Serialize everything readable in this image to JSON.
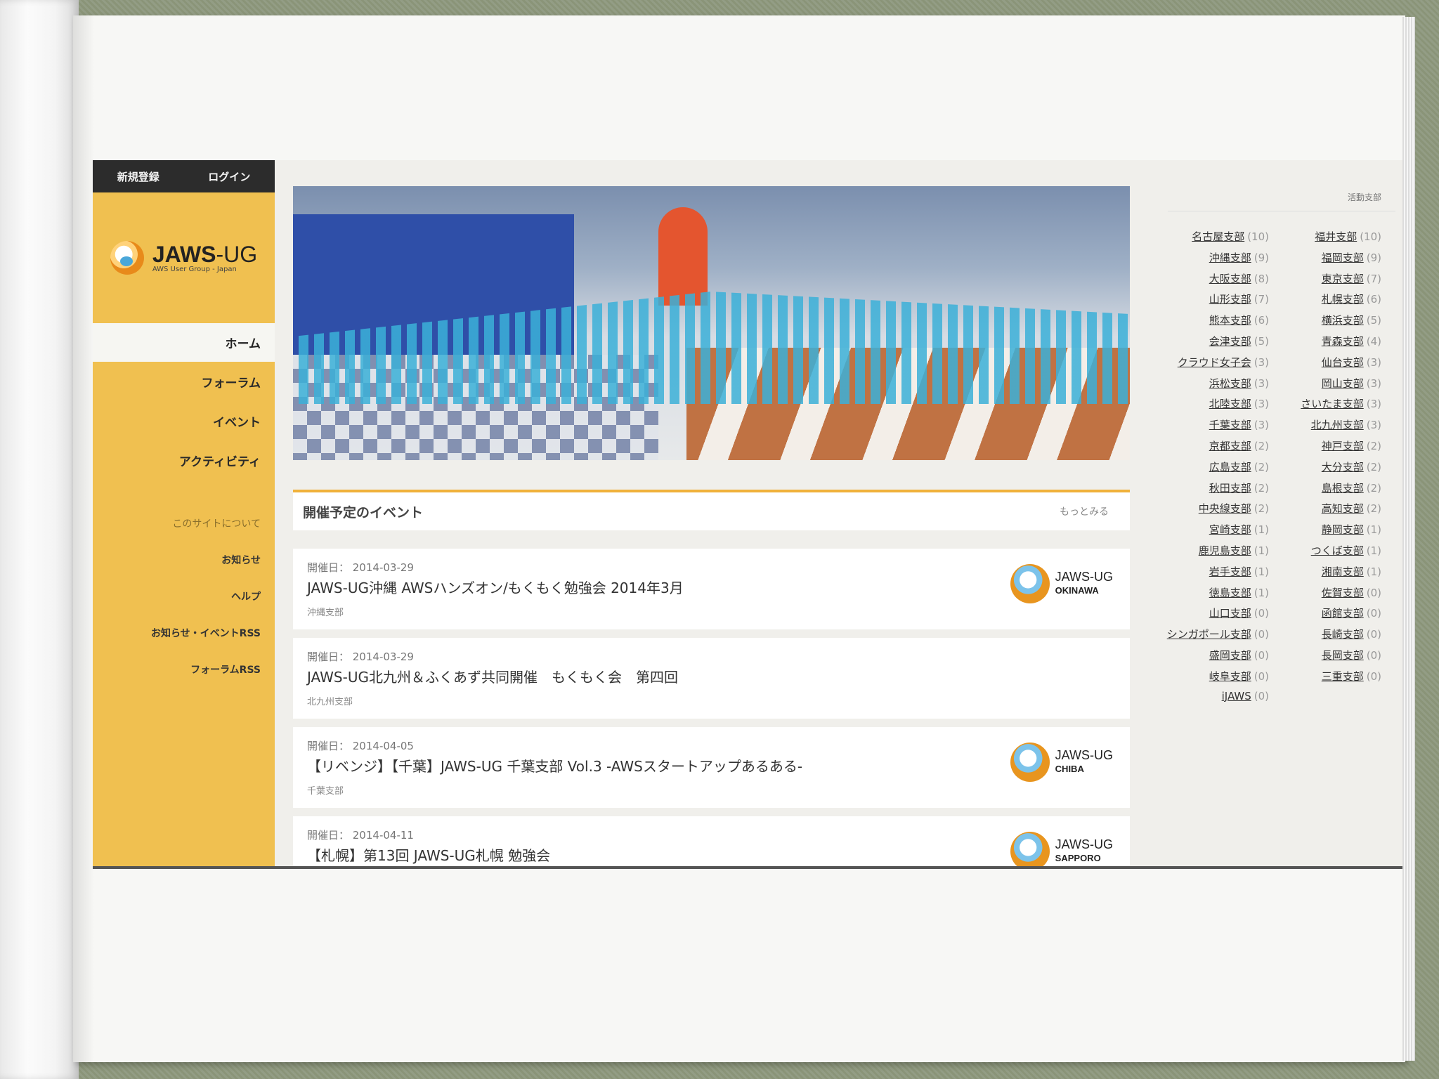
{
  "auth": {
    "register": "新規登録",
    "login": "ログイン"
  },
  "logo": {
    "title": "JAWS",
    "title_suffix": "-UG",
    "subtitle": "AWS User Group - Japan"
  },
  "nav": {
    "home": "ホーム",
    "forum": "フォーラム",
    "event": "イベント",
    "activity": "アクティビティ",
    "about": "このサイトについて",
    "news": "お知らせ",
    "help": "ヘルプ",
    "rss_news": "お知らせ・イベントRSS",
    "rss_forum": "フォーラムRSS"
  },
  "events": {
    "title": "開催予定のイベント",
    "more": "もっとみる",
    "items": [
      {
        "date": "開催日： 2014-03-29",
        "title": "JAWS-UG沖縄 AWSハンズオン/もくもく勉強会 2014年3月",
        "branch": "沖縄支部",
        "logo_text": "JAWS-UG",
        "logo_sub": "OKINAWA",
        "has_logo": true
      },
      {
        "date": "開催日： 2014-03-29",
        "title": "JAWS-UG北九州＆ふくあず共同開催　もくもく会　第四回",
        "branch": "北九州支部",
        "has_logo": false
      },
      {
        "date": "開催日： 2014-04-05",
        "title": "【リベンジ】【千葉】JAWS-UG 千葉支部 Vol.3 -AWSスタートアップあるある-",
        "branch": "千葉支部",
        "logo_text": "JAWS-UG",
        "logo_sub": "CHIBA",
        "has_logo": true
      },
      {
        "date": "開催日： 2014-04-11",
        "title": "【札幌】第13回 JAWS-UG札幌 勉強会",
        "branch": "",
        "logo_text": "JAWS-UG",
        "logo_sub": "SAPPORO",
        "has_logo": true
      }
    ]
  },
  "branches": {
    "title": "活動支部",
    "left": [
      {
        "name": "名古屋支部",
        "count": "(10)"
      },
      {
        "name": "沖縄支部",
        "count": "(9)"
      },
      {
        "name": "大阪支部",
        "count": "(8)"
      },
      {
        "name": "山形支部",
        "count": "(7)"
      },
      {
        "name": "熊本支部",
        "count": "(6)"
      },
      {
        "name": "会津支部",
        "count": "(5)"
      },
      {
        "name": "クラウド女子会",
        "count": "(3)"
      },
      {
        "name": "浜松支部",
        "count": "(3)"
      },
      {
        "name": "北陸支部",
        "count": "(3)"
      },
      {
        "name": "千葉支部",
        "count": "(3)"
      },
      {
        "name": "京都支部",
        "count": "(2)"
      },
      {
        "name": "広島支部",
        "count": "(2)"
      },
      {
        "name": "秋田支部",
        "count": "(2)"
      },
      {
        "name": "中央線支部",
        "count": "(2)"
      },
      {
        "name": "宮崎支部",
        "count": "(1)"
      },
      {
        "name": "鹿児島支部",
        "count": "(1)"
      },
      {
        "name": "岩手支部",
        "count": "(1)"
      },
      {
        "name": "徳島支部",
        "count": "(1)"
      },
      {
        "name": "山口支部",
        "count": "(0)"
      },
      {
        "name": "シンガポール支部",
        "count": "(0)"
      },
      {
        "name": "盛岡支部",
        "count": "(0)"
      },
      {
        "name": "岐阜支部",
        "count": "(0)"
      },
      {
        "name": "iJAWS",
        "count": "(0)"
      }
    ],
    "right": [
      {
        "name": "福井支部",
        "count": "(10)"
      },
      {
        "name": "福岡支部",
        "count": "(9)"
      },
      {
        "name": "東京支部",
        "count": "(7)"
      },
      {
        "name": "札幌支部",
        "count": "(6)"
      },
      {
        "name": "横浜支部",
        "count": "(5)"
      },
      {
        "name": "青森支部",
        "count": "(4)"
      },
      {
        "name": "仙台支部",
        "count": "(3)"
      },
      {
        "name": "岡山支部",
        "count": "(3)"
      },
      {
        "name": "さいたま支部",
        "count": "(3)"
      },
      {
        "name": "北九州支部",
        "count": "(3)"
      },
      {
        "name": "神戸支部",
        "count": "(2)"
      },
      {
        "name": "大分支部",
        "count": "(2)"
      },
      {
        "name": "島根支部",
        "count": "(2)"
      },
      {
        "name": "高知支部",
        "count": "(2)"
      },
      {
        "name": "静岡支部",
        "count": "(1)"
      },
      {
        "name": "つくば支部",
        "count": "(1)"
      },
      {
        "name": "湘南支部",
        "count": "(1)"
      },
      {
        "name": "佐賀支部",
        "count": "(0)"
      },
      {
        "name": "函館支部",
        "count": "(0)"
      },
      {
        "name": "長崎支部",
        "count": "(0)"
      },
      {
        "name": "長岡支部",
        "count": "(0)"
      },
      {
        "name": "三重支部",
        "count": "(0)"
      }
    ]
  }
}
